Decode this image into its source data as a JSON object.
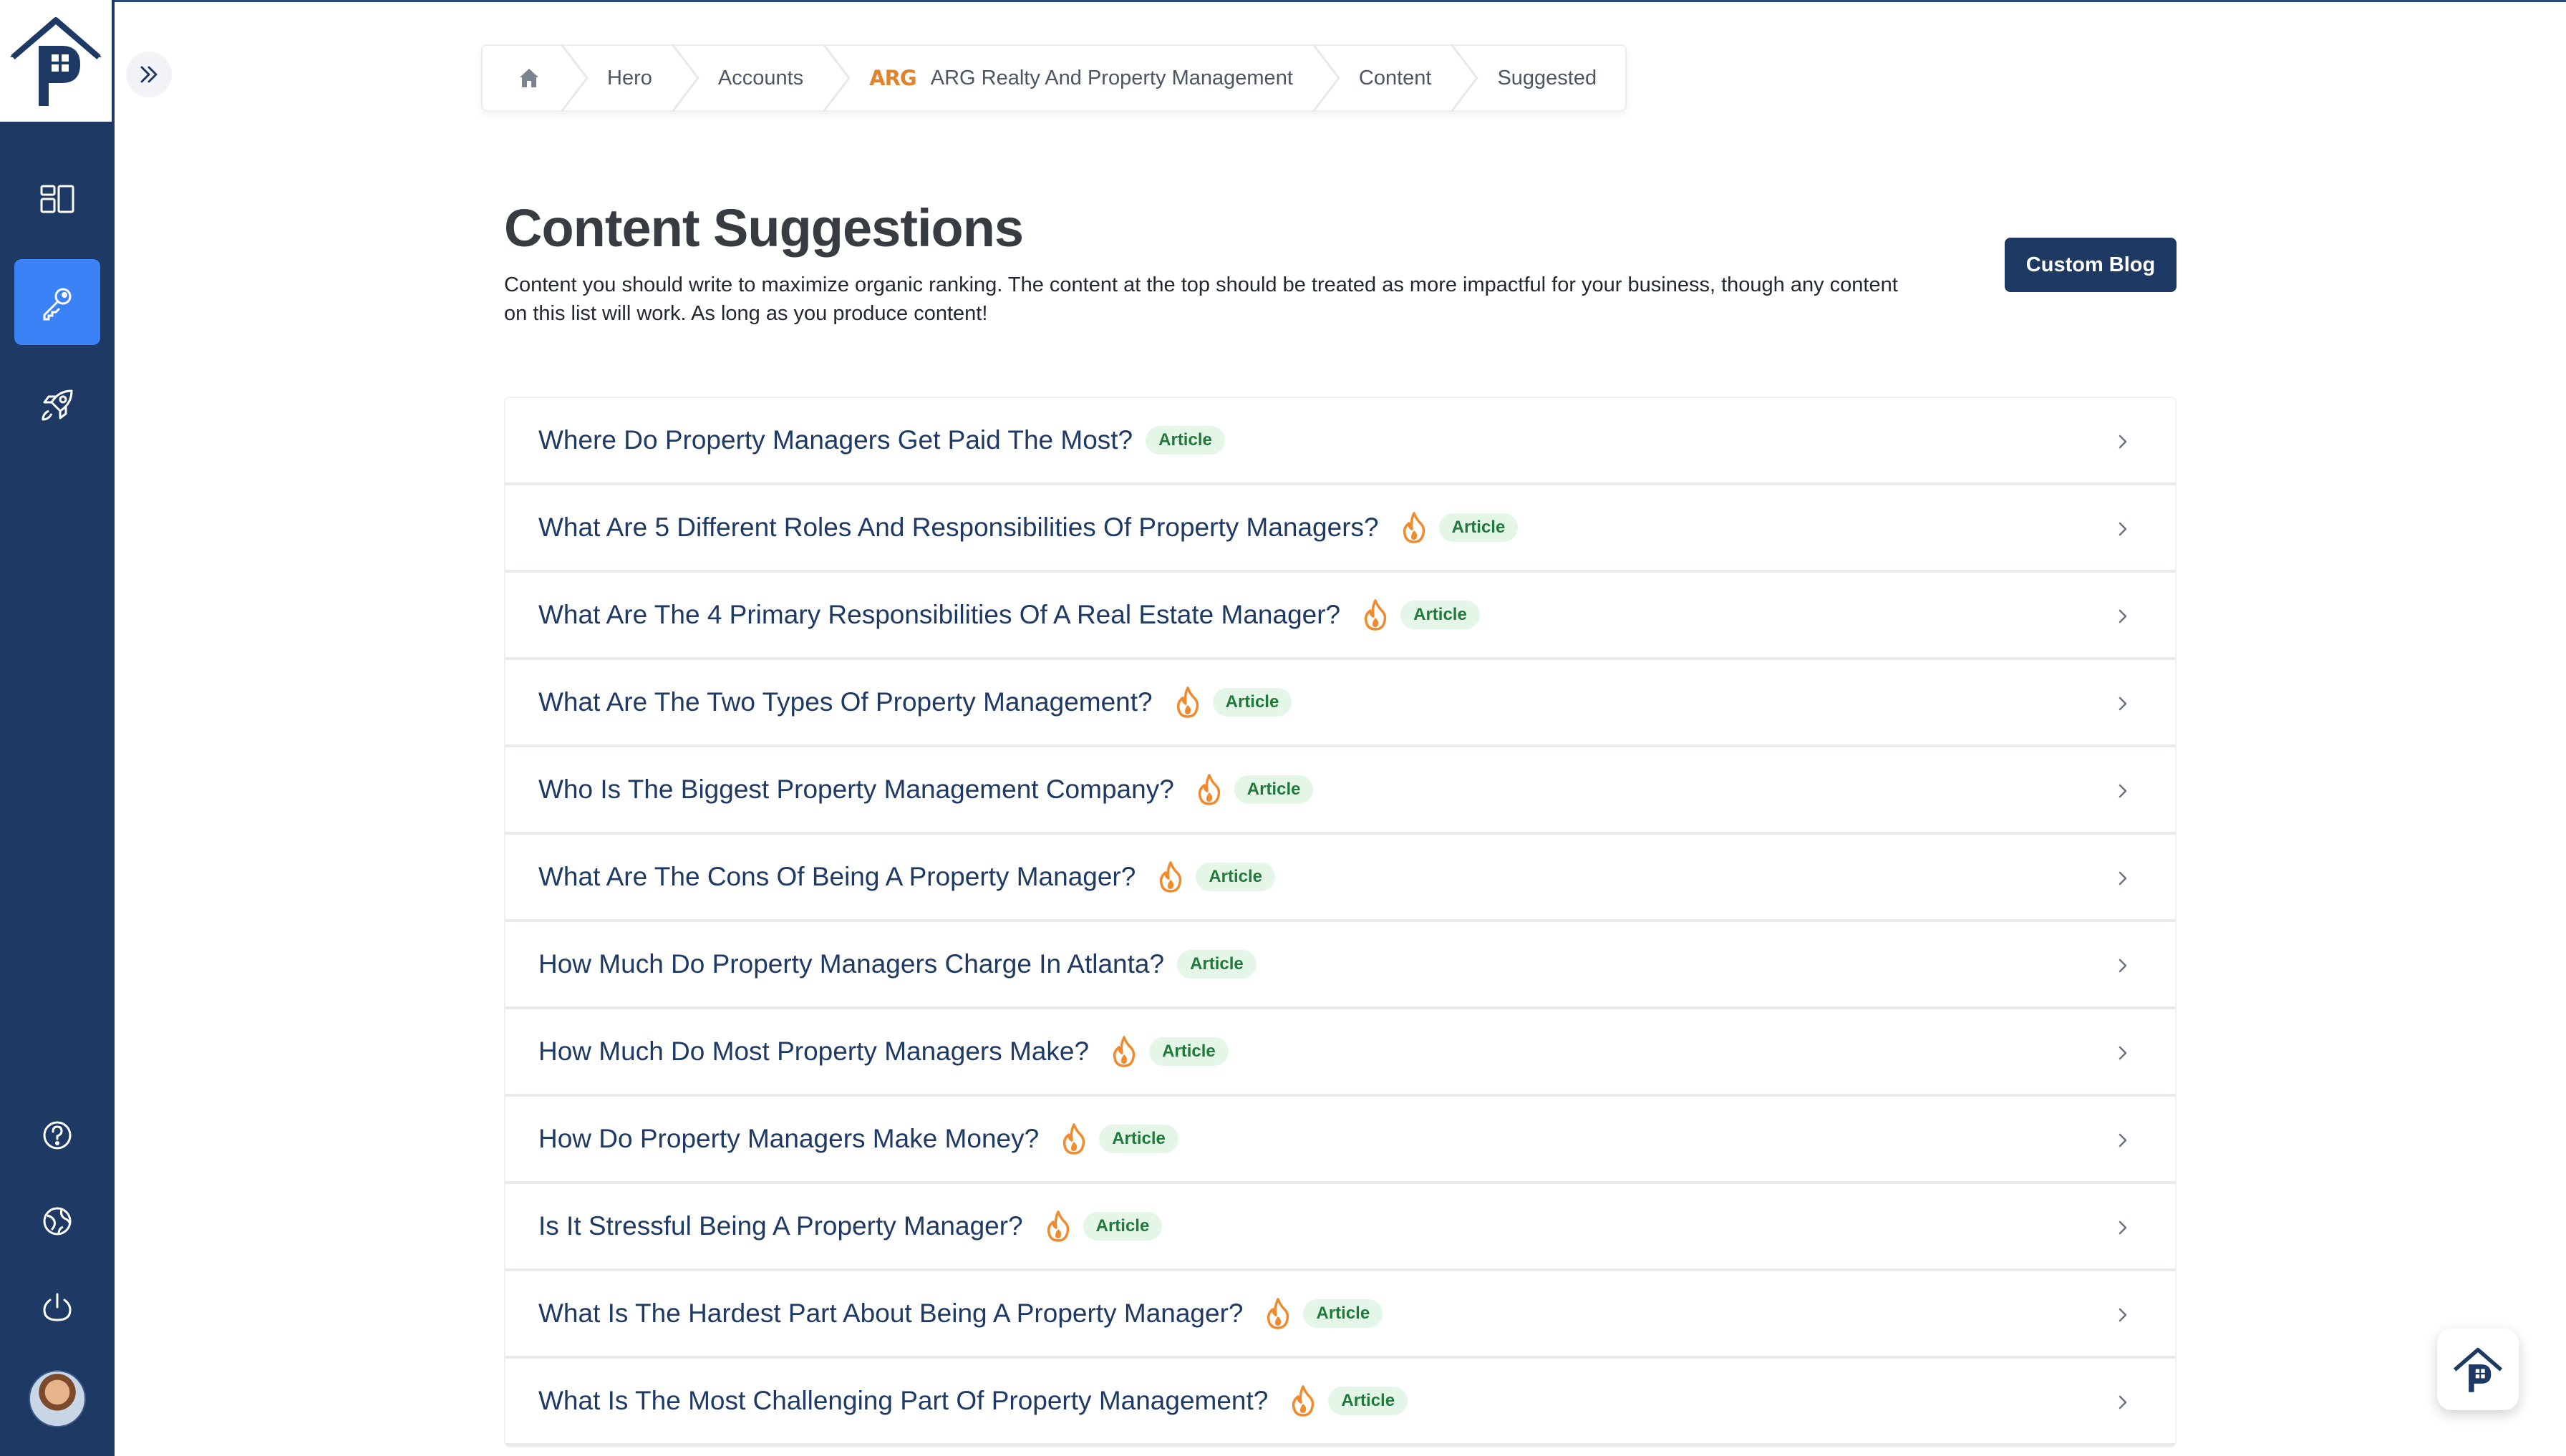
{
  "colors": {
    "sidebar_bg": "#1e3a64",
    "accent": "#3b82f6",
    "title_text": "#1e3a64",
    "badge_bg": "#e3f6e8",
    "badge_text": "#1f7a3a",
    "fire": "#f08a2c"
  },
  "sidebar": {
    "logo_icon": "property-house-logo-icon",
    "nav": [
      {
        "name": "dashboard",
        "icon": "dashboard-icon",
        "active": false
      },
      {
        "name": "keywords",
        "icon": "key-icon",
        "active": true
      },
      {
        "name": "launch",
        "icon": "rocket-icon",
        "active": false
      }
    ],
    "bottom": [
      {
        "name": "help",
        "icon": "help-circle-icon"
      },
      {
        "name": "globe",
        "icon": "globe-icon"
      },
      {
        "name": "logout",
        "icon": "power-icon"
      }
    ]
  },
  "breadcrumb": {
    "home_icon": "home-icon",
    "items": [
      "Hero",
      "Accounts",
      "ARG Realty And Property Management",
      "Content",
      "Suggested"
    ],
    "account_logo": "ARG"
  },
  "header": {
    "title": "Content Suggestions",
    "description": "Content you should write to maximize organic ranking. The content at the top should be treated as more impactful for your business, though any content on this list will work. As long as you produce content!",
    "custom_blog_label": "Custom Blog"
  },
  "suggestions": [
    {
      "title": "Where Do Property Managers Get Paid The Most?",
      "trending": false,
      "type": "Article"
    },
    {
      "title": "What Are 5 Different Roles And Responsibilities Of Property Managers?",
      "trending": true,
      "type": "Article"
    },
    {
      "title": "What Are The 4 Primary Responsibilities Of A Real Estate Manager?",
      "trending": true,
      "type": "Article"
    },
    {
      "title": "What Are The Two Types Of Property Management?",
      "trending": true,
      "type": "Article"
    },
    {
      "title": "Who Is The Biggest Property Management Company?",
      "trending": true,
      "type": "Article"
    },
    {
      "title": "What Are The Cons Of Being A Property Manager?",
      "trending": true,
      "type": "Article"
    },
    {
      "title": "How Much Do Property Managers Charge In Atlanta?",
      "trending": false,
      "type": "Article"
    },
    {
      "title": "How Much Do Most Property Managers Make?",
      "trending": true,
      "type": "Article"
    },
    {
      "title": "How Do Property Managers Make Money?",
      "trending": true,
      "type": "Article"
    },
    {
      "title": "Is It Stressful Being A Property Manager?",
      "trending": true,
      "type": "Article"
    },
    {
      "title": "What Is The Hardest Part About Being A Property Manager?",
      "trending": true,
      "type": "Article"
    },
    {
      "title": "What Is The Most Challenging Part Of Property Management?",
      "trending": true,
      "type": "Article"
    }
  ]
}
